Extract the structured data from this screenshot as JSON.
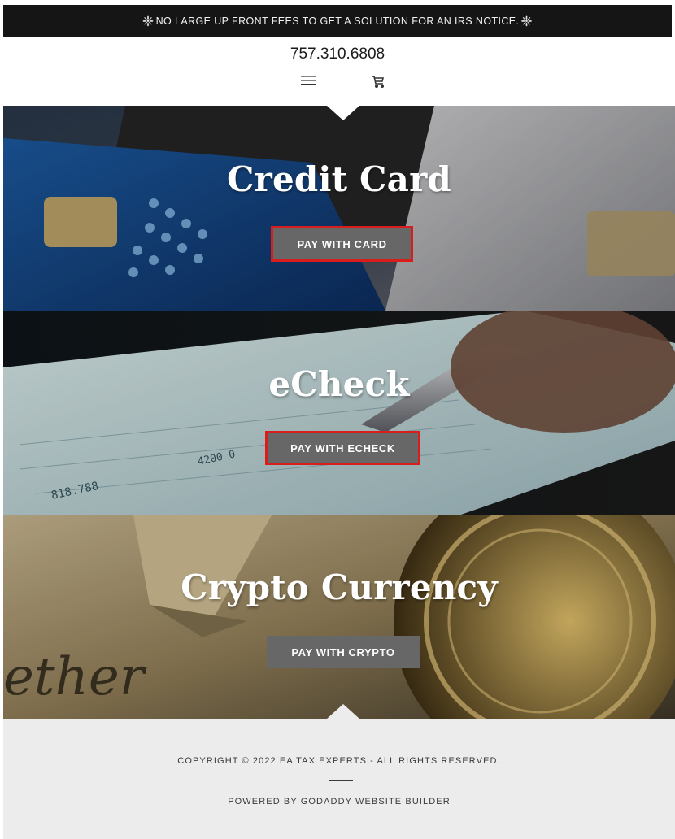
{
  "announcement": {
    "text": "NO LARGE UP FRONT FEES TO GET A SOLUTION FOR AN IRS NOTICE."
  },
  "header": {
    "phone": "757.310.6808"
  },
  "icons": {
    "menu": "hamburger-menu-icon",
    "cart": "shopping-cart-icon",
    "announcement_marks": "snowflake-icon"
  },
  "sections": [
    {
      "title": "Credit Card",
      "button": "PAY WITH CARD",
      "highlighted": true
    },
    {
      "title": "eCheck",
      "button": "PAY WITH ECHECK",
      "highlighted": true
    },
    {
      "title": "Crypto Currency",
      "button": "PAY WITH CRYPTO",
      "highlighted": false
    }
  ],
  "footer": {
    "copyright": "COPYRIGHT © 2022 EA TAX EXPERTS - ALL RIGHTS RESERVED.",
    "powered_by": "POWERED BY GODADDY WEBSITE BUILDER"
  },
  "colors": {
    "announcement_bg": "#151515",
    "button_bg": "#676767",
    "highlight_border": "#d91c1c",
    "footer_bg": "#ececec"
  }
}
